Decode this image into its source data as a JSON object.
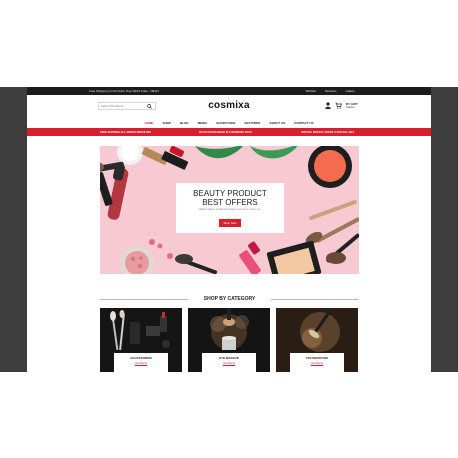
{
  "topbar": {
    "shipping_text": "Free Shipping On All Order Over $100 Code : NEW1",
    "links": [
      "Wishlist",
      "Services",
      "Gallery"
    ]
  },
  "header": {
    "search_placeholder": "Search Products",
    "logo": "cosmixa",
    "cart_title": "MY CART",
    "cart_count": "0 items"
  },
  "nav": {
    "items": [
      "HOME",
      "SHOP",
      "BLOG",
      "MEDIA",
      "SHORTCODE",
      "FEATURES",
      "ABOUT US",
      "CONTACT US"
    ]
  },
  "promo": {
    "left": "FREE SHIPPING ALL ORDER ABOVE $99",
    "center": "30 DAYS EXCHANGE IN 6 WORKING DAYS",
    "right": "SPECIAL WEEKLY OFFER & SPECIAL GIFT"
  },
  "hero": {
    "title_line1": "BEAUTY PRODUCT",
    "title_line2": "BEST OFFERS",
    "subtitle": "Nullam aliquet vestibulum augue non varius. Cras nec.",
    "button": "Shop Now"
  },
  "category_section": {
    "title": "SHOP BY CATEGORY",
    "cards": [
      {
        "name": "ACCESSORIES",
        "link": "View More"
      },
      {
        "name": "EYE MAKEUP",
        "link": "View More"
      },
      {
        "name": "FOUNDATIONS",
        "link": "View More"
      }
    ]
  },
  "colors": {
    "accent": "#d71f2d",
    "frame": "#3d3d3d",
    "topbar": "#1c1c1c",
    "hero_bg": "#f7c9d3"
  }
}
